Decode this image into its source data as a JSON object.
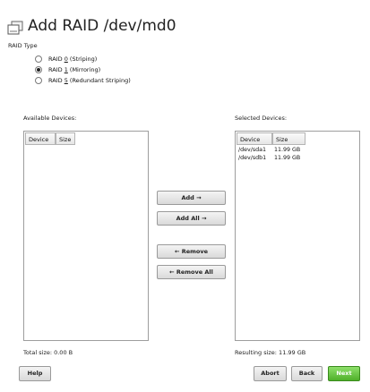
{
  "title": "Add RAID /dev/md0",
  "raid_type": {
    "label": "RAID Type",
    "options": [
      {
        "prefix": "RAID ",
        "mnemonic": "0",
        "suffix": " (Striping)",
        "selected": false
      },
      {
        "prefix": "RAID ",
        "mnemonic": "1",
        "suffix": " (Mirroring)",
        "selected": true
      },
      {
        "prefix": "RAID ",
        "mnemonic": "5",
        "suffix": " (Redundant Striping)",
        "selected": false
      }
    ]
  },
  "available": {
    "label": "Available Devices:",
    "columns": [
      "Device",
      "Size"
    ],
    "rows": [],
    "total_label": "Total size: 0.00 B"
  },
  "selected": {
    "label": "Selected Devices:",
    "columns": [
      "Device",
      "Size"
    ],
    "rows": [
      {
        "device": "/dev/sda1",
        "size": "11.99 GB"
      },
      {
        "device": "/dev/sdb1",
        "size": "11.99 GB"
      }
    ],
    "total_label": "Resulting size: 11.99 GB"
  },
  "actions": {
    "add_label": "Add →",
    "add_all_label": "Add All →",
    "remove_label": "← Remove",
    "remove_all_label": "← Remove All"
  },
  "footer": {
    "help_label": "Help",
    "abort_label": "Abort",
    "back_label": "Back",
    "next_label": "Next"
  },
  "icons": {
    "title": "hard-disk-icon"
  },
  "colors": {
    "next_button": "#4fb02a"
  }
}
